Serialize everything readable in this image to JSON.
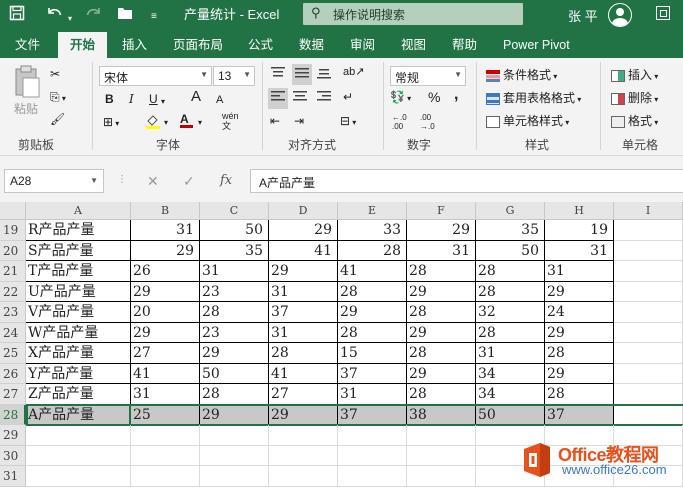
{
  "titlebar": {
    "doc_title": "产量统计  -  Excel",
    "search_placeholder": "操作说明搜索",
    "user_name": "张 平"
  },
  "tabs": [
    "文件",
    "开始",
    "插入",
    "页面布局",
    "公式",
    "数据",
    "审阅",
    "视图",
    "帮助",
    "Power Pivot"
  ],
  "ribbon": {
    "clipboard": {
      "paste": "粘贴",
      "label": "剪贴板"
    },
    "font": {
      "family": "宋体",
      "size": "13",
      "label": "字体",
      "bold": "B",
      "italic": "I",
      "underline": "U",
      "grow": "A",
      "shrink": "A",
      "wen": "wén"
    },
    "alignment": {
      "label": "对齐方式"
    },
    "number": {
      "format": "常规",
      "label": "数字",
      "percent": "%",
      "comma": ","
    },
    "styles": {
      "label": "样式",
      "conditional": "条件格式",
      "table": "套用表格格式",
      "cell": "单元格样式"
    },
    "cells": {
      "label": "单元格",
      "insert": "插入",
      "delete": "删除",
      "format": "格式"
    }
  },
  "formula_bar": {
    "name_box": "A28",
    "fx": "fx",
    "content": "A产品产量"
  },
  "columns": [
    "A",
    "B",
    "C",
    "D",
    "E",
    "F",
    "G",
    "H",
    "I"
  ],
  "rows": [
    {
      "num": "19",
      "type": "num",
      "cells": [
        "R产品产量",
        "31",
        "50",
        "29",
        "33",
        "29",
        "35",
        "19"
      ]
    },
    {
      "num": "20",
      "type": "num",
      "cells": [
        "S产品产量",
        "29",
        "35",
        "41",
        "28",
        "31",
        "50",
        "31"
      ]
    },
    {
      "num": "21",
      "type": "text",
      "cells": [
        "T产品产量",
        "26",
        "31",
        "29",
        "41",
        "28",
        "28",
        "31"
      ]
    },
    {
      "num": "22",
      "type": "text",
      "cells": [
        "U产品产量",
        "29",
        "23",
        "31",
        "28",
        "29",
        "28",
        "29"
      ]
    },
    {
      "num": "23",
      "type": "text",
      "cells": [
        "V产品产量",
        "20",
        "28",
        "37",
        "29",
        "28",
        "32",
        "24"
      ]
    },
    {
      "num": "24",
      "type": "text",
      "cells": [
        "W产品产量",
        "29",
        "23",
        "31",
        "28",
        "29",
        "28",
        "29"
      ]
    },
    {
      "num": "25",
      "type": "text",
      "cells": [
        "X产品产量",
        "27",
        "29",
        "28",
        "15",
        "28",
        "31",
        "28"
      ]
    },
    {
      "num": "26",
      "type": "text",
      "cells": [
        "Y产品产量",
        "41",
        "50",
        "41",
        "37",
        "29",
        "34",
        "29"
      ]
    },
    {
      "num": "27",
      "type": "text",
      "cells": [
        "Z产品产量",
        "31",
        "28",
        "27",
        "31",
        "28",
        "34",
        "28"
      ]
    },
    {
      "num": "28",
      "type": "text",
      "selected": true,
      "cells": [
        "A产品产量",
        "25",
        "29",
        "29",
        "37",
        "38",
        "50",
        "37"
      ]
    },
    {
      "num": "29",
      "type": "blank",
      "cells": []
    },
    {
      "num": "30",
      "type": "blank",
      "cells": []
    },
    {
      "num": "31",
      "type": "blank",
      "cells": []
    }
  ],
  "watermark": {
    "brand": "Office教程网",
    "url": "www.office26.com"
  }
}
